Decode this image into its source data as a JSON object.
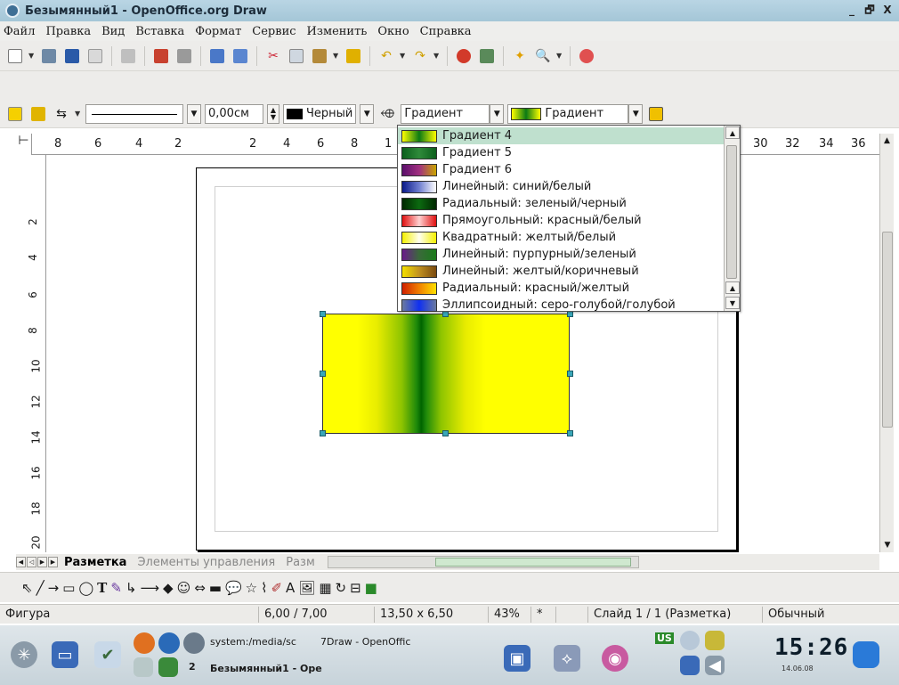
{
  "window": {
    "title": "Безымянный1 - OpenOffice.org Draw",
    "minimize": "_",
    "restore": "🗗",
    "close": "X"
  },
  "menu": [
    "Файл",
    "Правка",
    "Вид",
    "Вставка",
    "Формат",
    "Сервис",
    "Изменить",
    "Окно",
    "Справка"
  ],
  "format_bar": {
    "line_width": "0,00см",
    "line_color": "Черный",
    "area_style": "Градиент",
    "area_fill": "Градиент"
  },
  "ruler_h": [
    "8",
    "6",
    "4",
    "2",
    "2",
    "4",
    "6",
    "8",
    "1",
    "30",
    "32",
    "34",
    "36"
  ],
  "ruler_v": [
    "2",
    "4",
    "6",
    "8",
    "10",
    "12",
    "14",
    "16",
    "18",
    "20"
  ],
  "gradient_list": [
    {
      "label": "Градиент 4",
      "colors": [
        "#ffff00",
        "#0b7a14",
        "#ffff00"
      ],
      "selected": true
    },
    {
      "label": "Градиент 5",
      "colors": [
        "#0b5f1c",
        "#2f8a3a",
        "#0b5f1c"
      ],
      "selected": false
    },
    {
      "label": "Градиент 6",
      "colors": [
        "#5a0f6b",
        "#a03080",
        "#c9a400"
      ],
      "selected": false
    },
    {
      "label": "Линейный: синий/белый",
      "colors": [
        "#0a1a8a",
        "#6f7fd0",
        "#ffffff"
      ],
      "selected": false
    },
    {
      "label": "Радиальный: зеленый/черный",
      "colors": [
        "#002800",
        "#0c6a10",
        "#002800"
      ],
      "selected": false
    },
    {
      "label": "Прямоугольный: красный/белый",
      "colors": [
        "#e01010",
        "#ffd0d0",
        "#e01010"
      ],
      "selected": false
    },
    {
      "label": "Квадратный: желтый/белый",
      "colors": [
        "#f4f000",
        "#fffff0",
        "#f4f000"
      ],
      "selected": false
    },
    {
      "label": "Линейный: пурпурный/зеленый",
      "colors": [
        "#6a1a8a",
        "#3a6a3a",
        "#1a7a1a"
      ],
      "selected": false
    },
    {
      "label": "Линейный: желтый/коричневый",
      "colors": [
        "#f4e000",
        "#c09020",
        "#7a4a10"
      ],
      "selected": false
    },
    {
      "label": "Радиальный: красный/желтый",
      "colors": [
        "#d02000",
        "#f08000",
        "#ffe000"
      ],
      "selected": false
    },
    {
      "label": "Эллипсоидный: серо-голубой/голубой",
      "colors": [
        "#6a7aa0",
        "#1030f0",
        "#6a7aa0"
      ],
      "selected": false
    }
  ],
  "tabs": {
    "active": "Разметка",
    "second": "Элементы управления",
    "third": "Разм"
  },
  "status": {
    "object": "Фигура",
    "position": "6,00 / 7,00",
    "size": "13,50 x 6,50",
    "zoom": "43%",
    "modified": "*",
    "slide": "Слайд 1 / 1 (Разметка)",
    "layout": "Обычный"
  },
  "taskbar": {
    "task_files": "system:/media/sc",
    "task_draw": "7Draw - OpenOffic",
    "task_doc": "Безымянный1 - Ope",
    "desktop_num": "2",
    "lang": "US",
    "time": "15:26",
    "date": "14.06.08"
  }
}
